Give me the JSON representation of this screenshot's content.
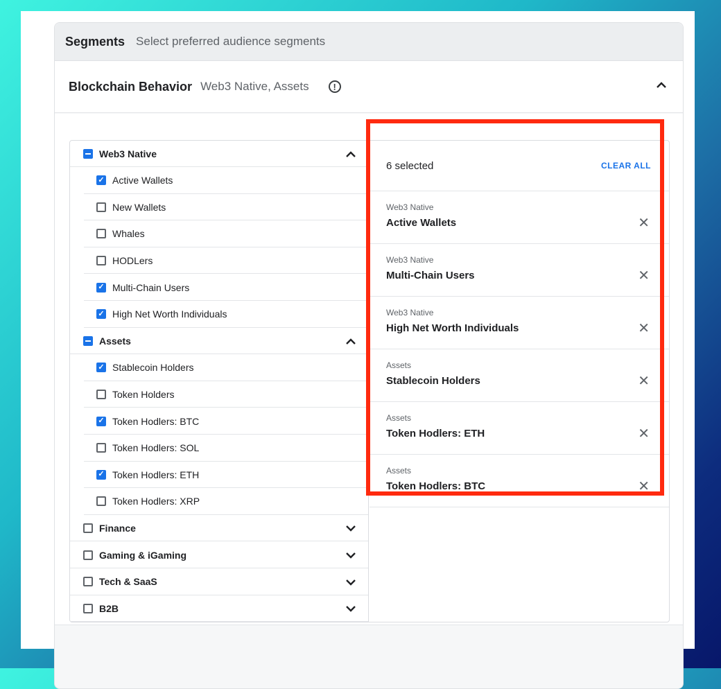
{
  "header": {
    "title": "Segments",
    "subtitle": "Select preferred audience segments"
  },
  "section": {
    "title": "Blockchain Behavior",
    "subtitle": "Web3 Native, Assets",
    "info_icon": "info-icon"
  },
  "tree": {
    "groups": [
      {
        "label": "Web3 Native",
        "state": "indeterminate",
        "expanded": true,
        "children": [
          {
            "label": "Active Wallets",
            "checked": true
          },
          {
            "label": "New Wallets",
            "checked": false
          },
          {
            "label": "Whales",
            "checked": false
          },
          {
            "label": "HODLers",
            "checked": false
          },
          {
            "label": "Multi-Chain Users",
            "checked": true
          },
          {
            "label": "High Net Worth Individuals",
            "checked": true
          }
        ]
      },
      {
        "label": "Assets",
        "state": "indeterminate",
        "expanded": true,
        "children": [
          {
            "label": "Stablecoin Holders",
            "checked": true
          },
          {
            "label": "Token Holders",
            "checked": false
          },
          {
            "label": "Token Hodlers: BTC",
            "checked": true
          },
          {
            "label": "Token Hodlers: SOL",
            "checked": false
          },
          {
            "label": "Token Hodlers: ETH",
            "checked": true
          },
          {
            "label": "Token Hodlers: XRP",
            "checked": false
          }
        ]
      },
      {
        "label": "Finance",
        "state": "unchecked",
        "expanded": false,
        "children": []
      },
      {
        "label": "Gaming & iGaming",
        "state": "unchecked",
        "expanded": false,
        "children": []
      },
      {
        "label": "Tech & SaaS",
        "state": "unchecked",
        "expanded": false,
        "children": []
      },
      {
        "label": "B2B",
        "state": "unchecked",
        "expanded": false,
        "children": []
      }
    ]
  },
  "selected": {
    "count_label": "6 selected",
    "clear_label": "CLEAR ALL",
    "items": [
      {
        "category": "Web3 Native",
        "name": "Active Wallets"
      },
      {
        "category": "Web3 Native",
        "name": "Multi-Chain Users"
      },
      {
        "category": "Web3 Native",
        "name": "High Net Worth Individuals"
      },
      {
        "category": "Assets",
        "name": "Stablecoin Holders"
      },
      {
        "category": "Assets",
        "name": "Token Hodlers: ETH"
      },
      {
        "category": "Assets",
        "name": "Token Hodlers: BTC"
      }
    ]
  },
  "colors": {
    "accent": "#1a73e8",
    "highlight": "#ff2a0f"
  }
}
